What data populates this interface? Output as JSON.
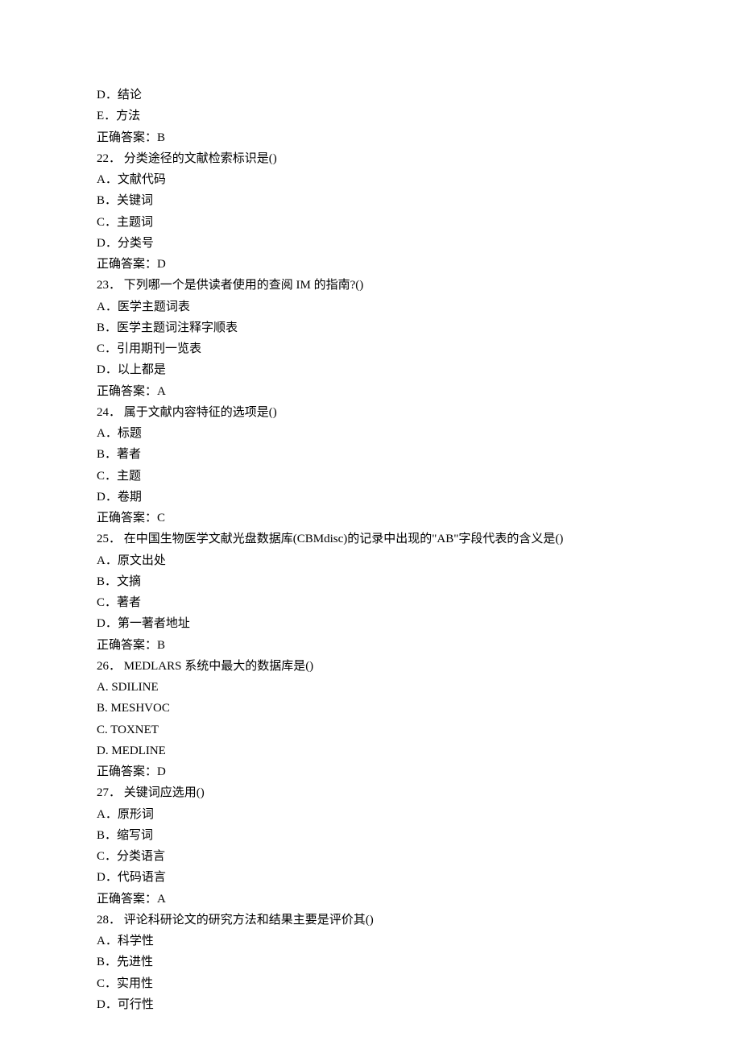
{
  "correct_label_prefix": "正确答案：",
  "pre_lines": [
    "D．结论",
    "E．方法"
  ],
  "pre_answer": "B",
  "questions": [
    {
      "number": "22．",
      "stem": "分类途径的文献检索标识是()",
      "options": [
        "A．文献代码",
        "B．关键词",
        "C．主题词",
        "D．分类号"
      ],
      "answer": "D"
    },
    {
      "number": "23．",
      "stem": "下列哪一个是供读者使用的查阅 IM 的指南?()",
      "options": [
        "A．医学主题词表",
        "B．医学主题词注释字顺表",
        "C．引用期刊一览表",
        "D．以上都是"
      ],
      "answer": "A"
    },
    {
      "number": "24．",
      "stem": "属于文献内容特征的选项是()",
      "options": [
        "A．标题",
        "B．著者",
        "C．主题",
        "D．卷期"
      ],
      "answer": "C"
    },
    {
      "number": "25．",
      "stem": "在中国生物医学文献光盘数据库(CBMdisc)的记录中出现的\"AB\"字段代表的含义是()",
      "options": [
        "A．原文出处",
        "B．文摘",
        "C．著者",
        "D．第一著者地址"
      ],
      "answer": "B"
    },
    {
      "number": "26．",
      "stem": "MEDLARS 系统中最大的数据库是()",
      "options": [
        "A. SDILINE",
        "B. MESHVOC",
        "C. TOXNET",
        "D. MEDLINE"
      ],
      "answer": "D"
    },
    {
      "number": "27．",
      "stem": "关键词应选用()",
      "options": [
        "A．原形词",
        "B．缩写词",
        "C．分类语言",
        "D．代码语言"
      ],
      "answer": "A"
    },
    {
      "number": "28．",
      "stem": "评论科研论文的研究方法和结果主要是评价其()",
      "options": [
        "A．科学性",
        "B．先进性",
        "C．实用性",
        "D．可行性"
      ],
      "answer": null
    }
  ]
}
